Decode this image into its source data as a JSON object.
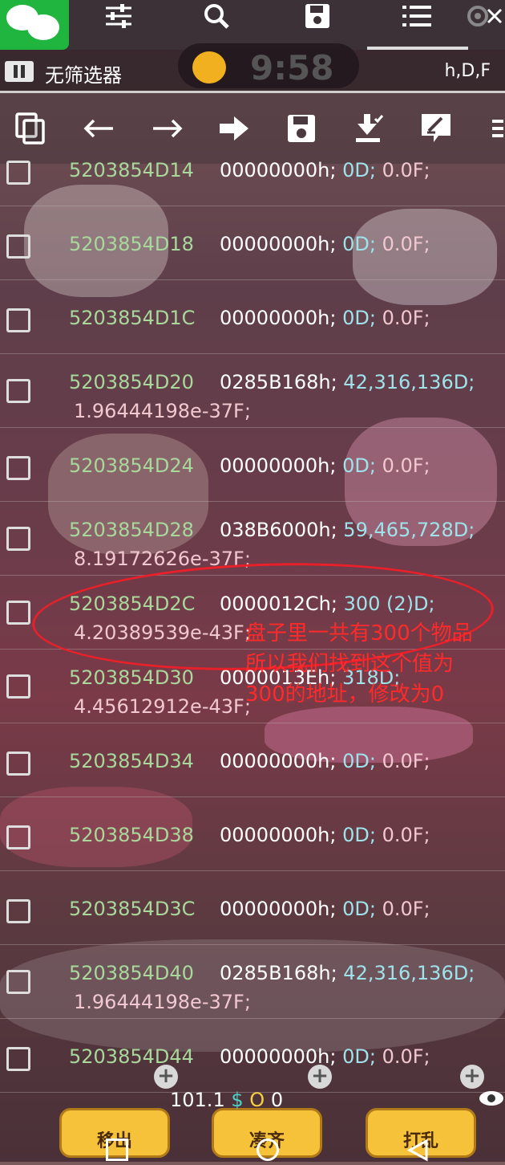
{
  "top_toolbar": {
    "icons": [
      "wechat-icon",
      "sliders-icon",
      "search-icon",
      "save-icon",
      "list-icon",
      "settings-icon",
      "close-icon"
    ]
  },
  "status": {
    "filter_label": "无筛选器",
    "clock": "9:58",
    "format": "h,D,F"
  },
  "action_toolbar": {
    "icons": [
      "copy-icon",
      "arrow-left-icon",
      "arrow-right-icon",
      "go-icon",
      "save-icon",
      "load-icon",
      "edit-icon",
      "menu-icon"
    ]
  },
  "rows": [
    {
      "address": "5203854D14",
      "hex": "00000000h;",
      "dec": "0D;",
      "float": "0.0F;",
      "float2": ""
    },
    {
      "address": "5203854D18",
      "hex": "00000000h;",
      "dec": "0D;",
      "float": "0.0F;",
      "float2": ""
    },
    {
      "address": "5203854D1C",
      "hex": "00000000h;",
      "dec": "0D;",
      "float": "0.0F;",
      "float2": ""
    },
    {
      "address": "5203854D20",
      "hex": "0285B168h;",
      "dec": "42,316,136D;",
      "float": "",
      "float2": "1.96444198e-37F;"
    },
    {
      "address": "5203854D24",
      "hex": "00000000h;",
      "dec": "0D;",
      "float": "0.0F;",
      "float2": ""
    },
    {
      "address": "5203854D28",
      "hex": "038B6000h;",
      "dec": "59,465,728D;",
      "float": "",
      "float2": "8.19172626e-37F;"
    },
    {
      "address": "5203854D2C",
      "hex": "0000012Ch;",
      "dec": "300 (2)D;",
      "float": "",
      "float2": "4.20389539e-43F;"
    },
    {
      "address": "5203854D30",
      "hex": "0000013Eh;",
      "dec": "318D;",
      "float": "",
      "float2": "4.45612912e-43F;"
    },
    {
      "address": "5203854D34",
      "hex": "00000000h;",
      "dec": "0D;",
      "float": "0.0F;",
      "float2": ""
    },
    {
      "address": "5203854D38",
      "hex": "00000000h;",
      "dec": "0D;",
      "float": "0.0F;",
      "float2": ""
    },
    {
      "address": "5203854D3C",
      "hex": "00000000h;",
      "dec": "0D;",
      "float": "0.0F;",
      "float2": ""
    },
    {
      "address": "5203854D40",
      "hex": "0285B168h;",
      "dec": "42,316,136D;",
      "float": "",
      "float2": "1.96444198e-37F;"
    },
    {
      "address": "5203854D44",
      "hex": "00000000h;",
      "dec": "0D;",
      "float": "0.0F;",
      "float2": ""
    }
  ],
  "annotation": {
    "line1": "盘子里一共有300个物品",
    "line2": "所以我们找到这个值为",
    "line3": "300的地址，修改为0",
    "color": "#ff2a2a"
  },
  "game_bar": {
    "btn_move_out": "移出",
    "btn_gather": "凑齐",
    "btn_shuffle": "打乱",
    "stat_value": "101.1",
    "stat_dollar": "$",
    "stat_o": "O",
    "stat_zero": "0"
  }
}
